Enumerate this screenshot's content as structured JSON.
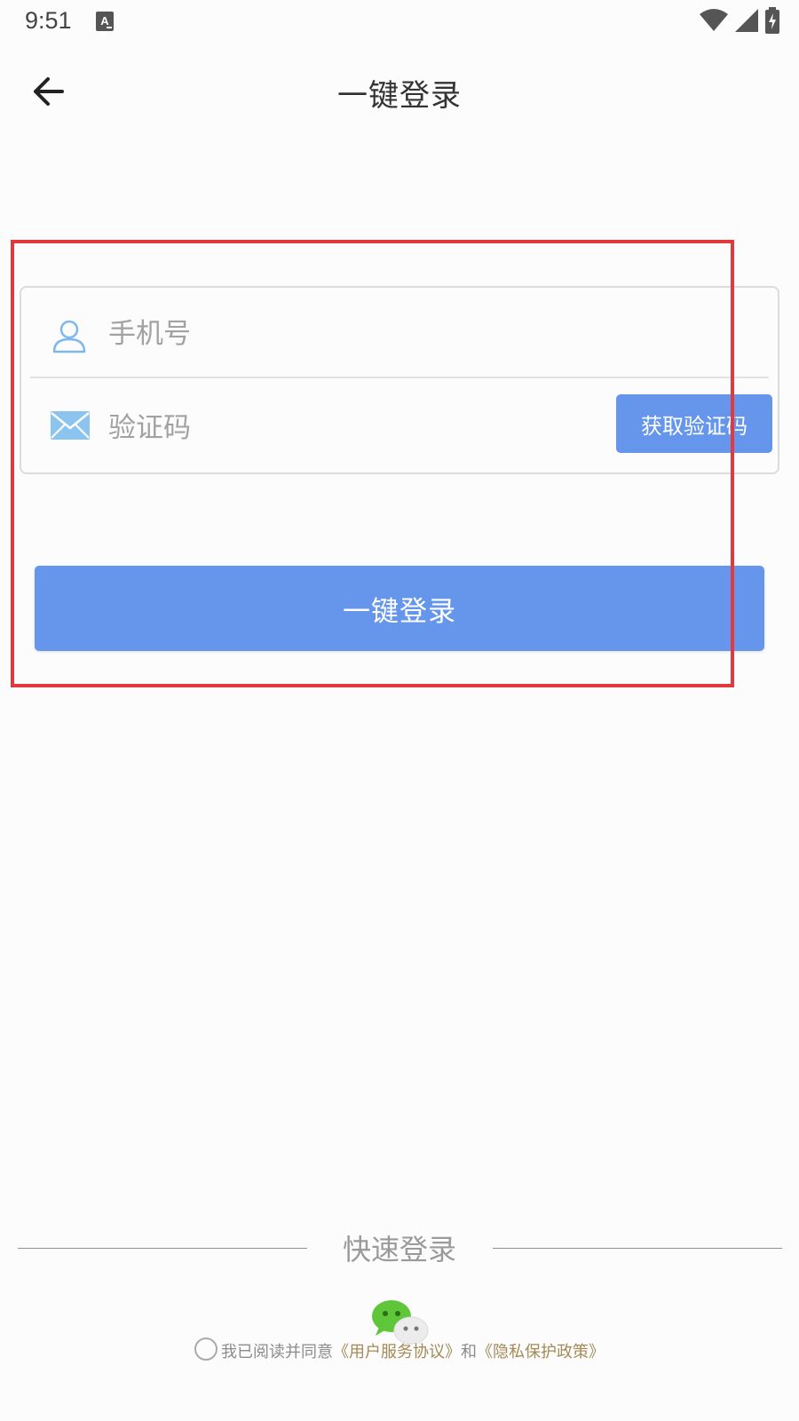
{
  "status_bar": {
    "time": "9:51",
    "icons": [
      "a-notification-icon",
      "wifi-icon",
      "signal-icon",
      "battery-charging-icon"
    ]
  },
  "header": {
    "back_icon": "arrow-left-icon",
    "title": "一键登录"
  },
  "form": {
    "phone": {
      "icon": "user-icon",
      "placeholder": "手机号",
      "value": ""
    },
    "code": {
      "icon": "mail-icon",
      "placeholder": "验证码",
      "value": "",
      "get_code_label": "获取验证码"
    }
  },
  "login_button_label": "一键登录",
  "quick_login": {
    "title": "快速登录",
    "wechat_icon": "wechat-icon"
  },
  "agreement": {
    "prefix": "我已阅读并同意",
    "user_agreement": "《用户服务协议》",
    "conjunction": "和",
    "privacy_policy": "《隐私保护政策》",
    "checked": false
  },
  "colors": {
    "primary": "#6596ec",
    "link": "#a48a55",
    "highlight": "#e03a3e",
    "icon_blue": "#7db8ec"
  }
}
